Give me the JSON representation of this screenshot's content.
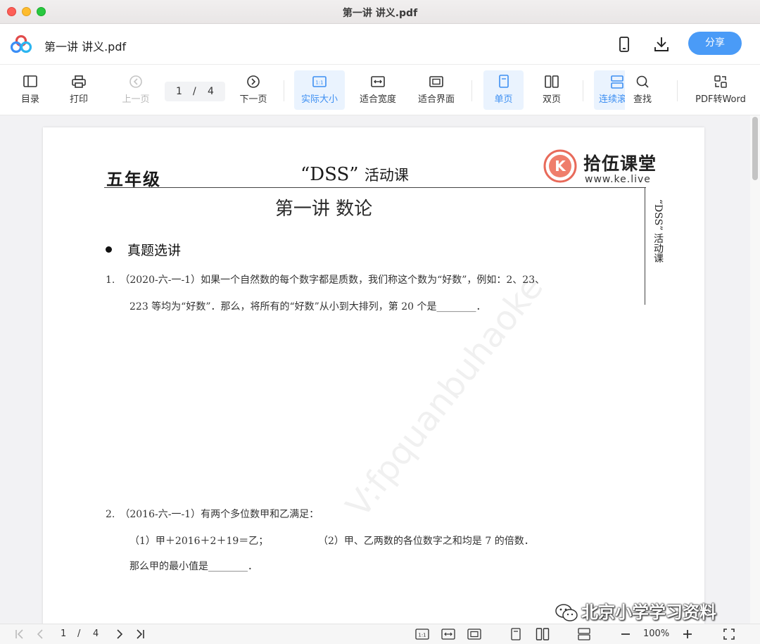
{
  "window": {
    "title": "第一讲 讲义.pdf"
  },
  "header": {
    "doc_title": "第一讲 讲义.pdf",
    "share_label": "分享",
    "icons": [
      "phone-icon",
      "download-icon"
    ]
  },
  "toolbar": {
    "toc": "目录",
    "print": "打印",
    "prev": "上一页",
    "page_current": "1",
    "page_sep": "/",
    "page_total": "4",
    "next": "下一页",
    "actual_size": "实际大小",
    "fit_width": "适合宽度",
    "fit_page": "适合界面",
    "single_page": "单页",
    "double_page": "双页",
    "continuous": "连续滚",
    "find": "查找",
    "pdf_to_word": "PDF转Word"
  },
  "document": {
    "grade": "五年级",
    "course": "“DSS”",
    "course_suffix": "活动课",
    "brand_name": "拾伍课堂",
    "brand_url": "www.ke.live",
    "side_label": "“DSS” 活动课",
    "lesson_title": "第一讲 数论",
    "section_title": "真题选讲",
    "q1_line1": "1.　（2020-六-一-1）如果一个自然数的每个数字都是质数，我们称这个数为“好数”，例如：2、23、",
    "q1_line2": "223 等均为“好数”．那么，将所有的“好数”从小到大排列，第 20 个是________．",
    "q2_line1": "2.　（2016-六-一-1）有两个多位数甲和乙满足：",
    "q2_line2a": "（1）甲＋2016＋2＋19＝乙；",
    "q2_line2b": "（2）甲、乙两数的各位数字之和均是 7 的倍数．",
    "q2_line3": "那么甲的最小值是________．",
    "watermark": "V:fpquanbuhaoke",
    "wechat_watermark": "北京小学学习资料"
  },
  "bottombar": {
    "page_current": "1",
    "page_sep": "/",
    "page_total": "4",
    "zoom": "100%"
  },
  "colors": {
    "accent": "#4a9bf7",
    "active_bg": "#eaf3fe"
  }
}
